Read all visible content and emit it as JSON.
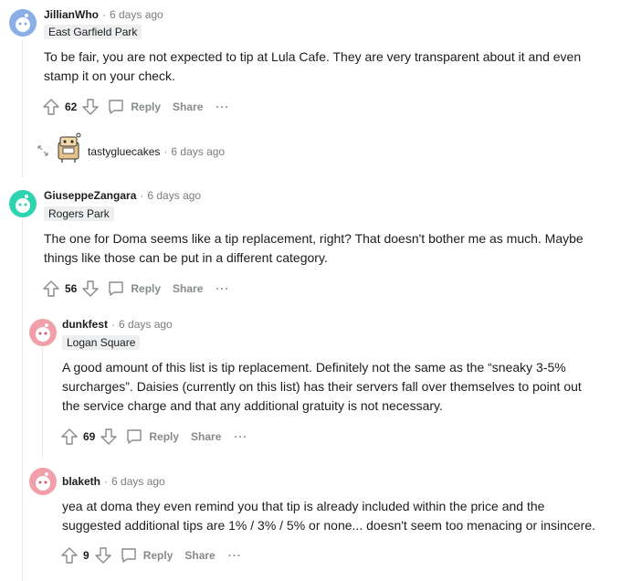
{
  "comments": [
    {
      "username": "JillianWho",
      "separator": "·",
      "time": "6 days ago",
      "flair": "East Garfield Park",
      "body_lines": [
        "To be fair, you are not expected to tip at Lula Cafe. They are very transparent about it and even",
        "stamp it on your check."
      ],
      "votes": "62",
      "reply_label": "Reply",
      "share_label": "Share",
      "more_label": "···",
      "avatar_color": "#8aaee6"
    },
    {
      "username": "GiuseppeZangara",
      "separator": "·",
      "time": "6 days ago",
      "flair": "Rogers Park",
      "body_lines": [
        "The one for Doma seems like a tip replacement, right? That doesn't bother me as much. Maybe",
        "things like those can be put in a different category."
      ],
      "votes": "56",
      "reply_label": "Reply",
      "share_label": "Share",
      "more_label": "···",
      "avatar_color": "#2ed3b0"
    },
    {
      "username": "dunkfest",
      "separator": "·",
      "time": "6 days ago",
      "flair": "Logan Square",
      "body_lines": [
        "A good amount of this list is tip replacement. Definitely not the same as the “sneaky 3-5%",
        "surcharges”. Daisies (currently on this list) has their servers fall over themselves to point out",
        "the service charge and that any additional gratuity is not necessary."
      ],
      "votes": "69",
      "reply_label": "Reply",
      "share_label": "Share",
      "more_label": "···",
      "avatar_color": "#f19fa8"
    },
    {
      "username": "blaketh",
      "separator": "·",
      "time": "6 days ago",
      "body_lines": [
        "yea at doma they even remind you that tip is already included within the price and the",
        "suggested additional tips are 1% / 3% / 5% or none... doesn't seem too menacing or insincere."
      ],
      "votes": "9",
      "reply_label": "Reply",
      "share_label": "Share",
      "more_label": "···",
      "avatar_color": "#f19fa8"
    }
  ],
  "collapsed": {
    "username": "tastygluecakes",
    "separator": "·",
    "time": "6 days ago",
    "expand_icon": "expand-arrows-icon",
    "avatar_icon": "snoo-avatar-icon"
  },
  "colors": {
    "text": "#1c1c1c",
    "muted": "#878a8c",
    "flair_bg": "#edeff1",
    "thread_line": "#e6e6e6"
  }
}
